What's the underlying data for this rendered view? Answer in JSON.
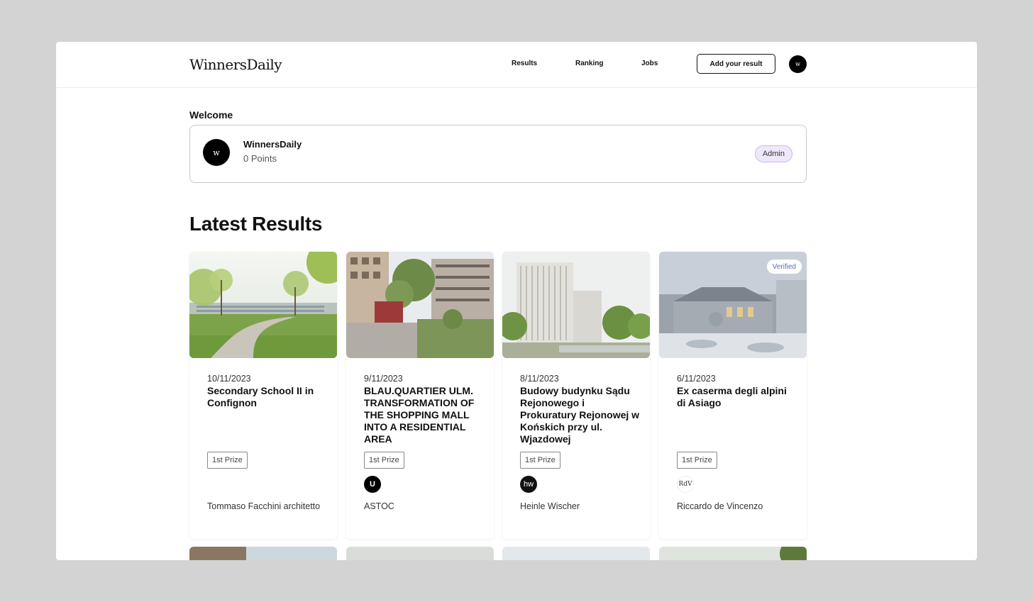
{
  "header": {
    "logo": "WinnersDaily",
    "nav": [
      "Results",
      "Ranking",
      "Jobs"
    ],
    "add_button": "Add your result",
    "avatar_letter": "w"
  },
  "welcome": {
    "title": "Welcome",
    "name": "WinnersDaily",
    "points": "0 Points",
    "badge": "Admin",
    "avatar_letter": "w"
  },
  "latest": {
    "title": "Latest Results",
    "cards": [
      {
        "date": "10/11/2023",
        "title": "Secondary School II in Confignon",
        "prize": "1st Prize",
        "author": "Tommaso Facchini architetto",
        "logo": "",
        "verified": ""
      },
      {
        "date": "9/11/2023",
        "title": "BLAU.QUARTIER ULM. TRANSFORMATION OF THE SHOPPING MALL INTO A RESIDENTIAL AREA",
        "prize": "1st Prize",
        "author": "ASTOC",
        "logo": "U",
        "verified": ""
      },
      {
        "date": "8/11/2023",
        "title": "Budowy budynku Sądu Rejonowego i Prokuratury Rejonowej w Końskich przy ul. Wjazdowej",
        "prize": "1st Prize",
        "author": "Heinle Wischer",
        "logo": "hw",
        "verified": ""
      },
      {
        "date": "6/11/2023",
        "title": "Ex caserma degli alpini di Asiago",
        "prize": "1st Prize",
        "author": "Riccardo de Vincenzo",
        "logo": "RdV",
        "verified": "Verified"
      }
    ]
  }
}
